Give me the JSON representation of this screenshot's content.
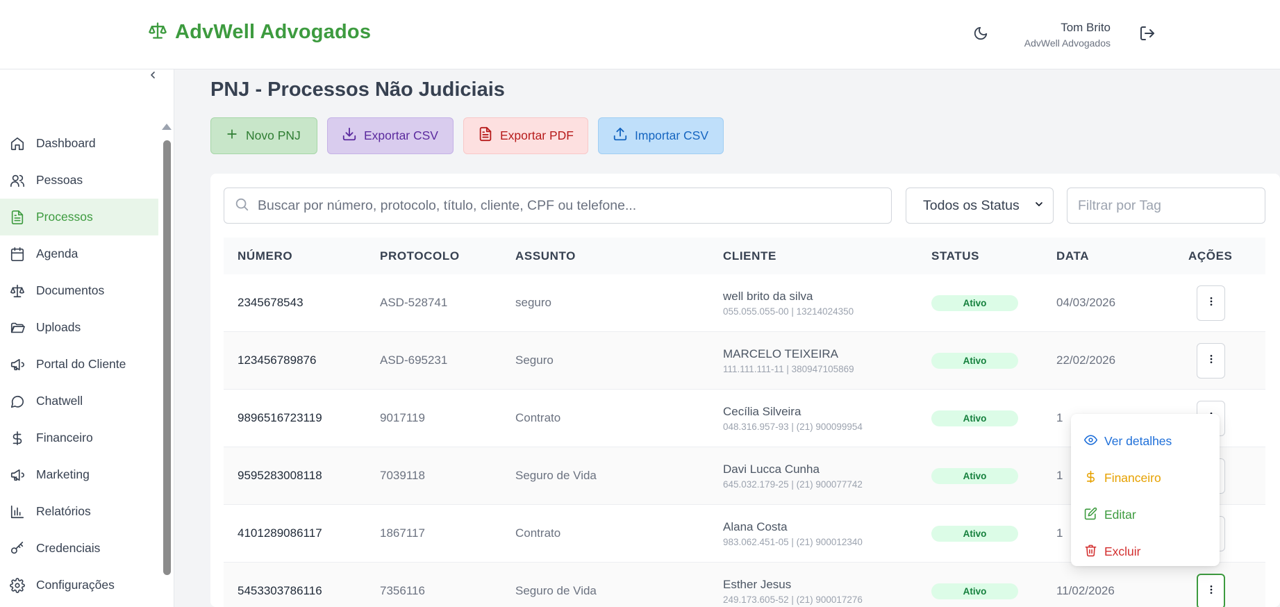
{
  "header": {
    "brand": "AdvWell Advogados",
    "user_name": "Tom Brito",
    "user_org": "AdvWell Advogados"
  },
  "sidebar": {
    "items": [
      {
        "label": "Dashboard",
        "icon": "home-icon"
      },
      {
        "label": "Pessoas",
        "icon": "users-icon"
      },
      {
        "label": "Processos",
        "icon": "file-text-icon",
        "active": true
      },
      {
        "label": "Agenda",
        "icon": "calendar-icon"
      },
      {
        "label": "Documentos",
        "icon": "scale-icon"
      },
      {
        "label": "Uploads",
        "icon": "folder-open-icon"
      },
      {
        "label": "Portal do Cliente",
        "icon": "megaphone-icon"
      },
      {
        "label": "Chatwell",
        "icon": "chat-icon"
      },
      {
        "label": "Financeiro",
        "icon": "dollar-icon"
      },
      {
        "label": "Marketing",
        "icon": "megaphone-icon"
      },
      {
        "label": "Relatórios",
        "icon": "bar-chart-icon"
      },
      {
        "label": "Credenciais",
        "icon": "key-icon"
      },
      {
        "label": "Configurações",
        "icon": "gear-icon"
      }
    ]
  },
  "page": {
    "title": "PNJ - Processos Não Judiciais",
    "actions": {
      "new": "Novo PNJ",
      "export_csv": "Exportar CSV",
      "export_pdf": "Exportar PDF",
      "import_csv": "Importar CSV"
    }
  },
  "filters": {
    "search_placeholder": "Buscar por número, protocolo, título, cliente, CPF ou telefone...",
    "status_selected": "Todos os Status",
    "tag_placeholder": "Filtrar por Tag"
  },
  "table": {
    "headers": [
      "NÚMERO",
      "PROTOCOLO",
      "ASSUNTO",
      "CLIENTE",
      "STATUS",
      "DATA",
      "AÇÕES"
    ],
    "rows": [
      {
        "numero": "2345678543",
        "protocolo": "ASD-528741",
        "assunto": "seguro",
        "cliente": "well brito da silva",
        "cliente_sub": "055.055.055-00 | 13214024350",
        "status": "Ativo",
        "data": "04/03/2026"
      },
      {
        "numero": "123456789876",
        "protocolo": "ASD-695231",
        "assunto": "Seguro",
        "cliente": "MARCELO TEIXEIRA",
        "cliente_sub": "111.111.111-11 | 380947105869",
        "status": "Ativo",
        "data": "22/02/2026"
      },
      {
        "numero": "9896516723119",
        "protocolo": "9017119",
        "assunto": "Contrato",
        "cliente": "Cecília Silveira",
        "cliente_sub": "048.316.957-93 | (21) 900099954",
        "status": "Ativo",
        "data": "1"
      },
      {
        "numero": "9595283008118",
        "protocolo": "7039118",
        "assunto": "Seguro de Vida",
        "cliente": "Davi Lucca Cunha",
        "cliente_sub": "645.032.179-25 | (21) 900077742",
        "status": "Ativo",
        "data": "1"
      },
      {
        "numero": "4101289086117",
        "protocolo": "1867117",
        "assunto": "Contrato",
        "cliente": "Alana Costa",
        "cliente_sub": "983.062.451-05 | (21) 900012340",
        "status": "Ativo",
        "data": "1"
      },
      {
        "numero": "5453303786116",
        "protocolo": "7356116",
        "assunto": "Seguro de Vida",
        "cliente": "Esther Jesus",
        "cliente_sub": "249.173.605-52 | (21) 900017276",
        "status": "Ativo",
        "data": "11/02/2026"
      }
    ]
  },
  "menu": {
    "items": [
      {
        "label": "Ver detalhes",
        "icon": "eye-icon",
        "color": "#1e6fd9"
      },
      {
        "label": "Financeiro",
        "icon": "dollar-icon",
        "color": "#e6a100"
      },
      {
        "label": "Editar",
        "icon": "edit-icon",
        "color": "#3d9b3f"
      },
      {
        "label": "Excluir",
        "icon": "trash-icon",
        "color": "#d32f2f"
      }
    ]
  },
  "colors": {
    "brand": "#3d9b3f",
    "active_bg": "#e8f5e9",
    "badge_bg": "#dcfce7",
    "badge_text": "#15803d"
  }
}
